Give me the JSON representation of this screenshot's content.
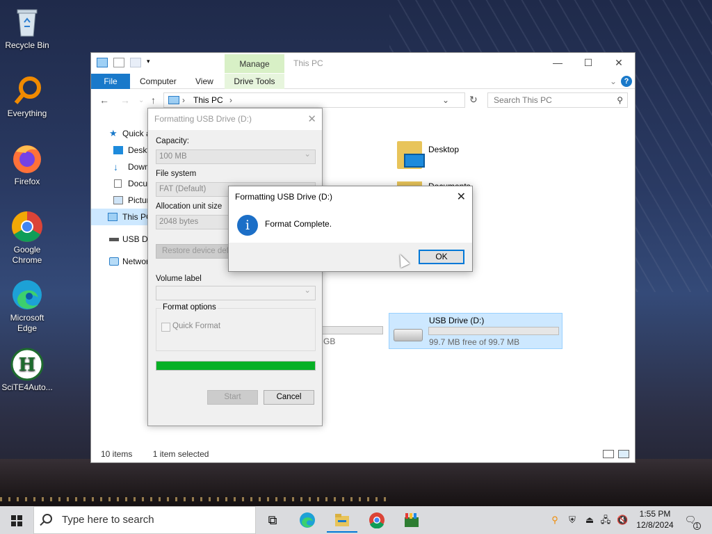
{
  "desktop": {
    "icons": [
      {
        "label": "Recycle Bin"
      },
      {
        "label": "Everything"
      },
      {
        "label": "Firefox"
      },
      {
        "label": "Google Chrome"
      },
      {
        "label": "Microsoft Edge"
      },
      {
        "label": "SciTE4Auto..."
      }
    ]
  },
  "explorer": {
    "title": "This PC",
    "manage_tab": "Manage",
    "ribbon_tabs": {
      "file": "File",
      "computer": "Computer",
      "view": "View",
      "drive_tools": "Drive Tools"
    },
    "help": "?",
    "address": "This PC",
    "search_placeholder": "Search This PC",
    "nav": [
      {
        "label": "Quick access"
      },
      {
        "label": "Desktop"
      },
      {
        "label": "Downloads"
      },
      {
        "label": "Documents"
      },
      {
        "label": "Pictures"
      },
      {
        "label": "This PC"
      },
      {
        "label": "USB Drive (D:)"
      },
      {
        "label": "Network"
      }
    ],
    "folder_desktop": "Desktop",
    "folder_documents": "Documents",
    "other_drive_size": "GB",
    "usb": {
      "name": "USB Drive (D:)",
      "free": "99.7 MB free of 99.7 MB",
      "used_fraction": 0.0
    },
    "status": {
      "items": "10 items",
      "selected": "1 item selected"
    }
  },
  "format_dialog": {
    "title": "Formatting USB Drive (D:)",
    "capacity_label": "Capacity:",
    "capacity_value": "100 MB",
    "fs_label": "File system",
    "fs_value": "FAT (Default)",
    "alloc_label": "Allocation unit size",
    "alloc_value": "2048 bytes",
    "restore_button": "Restore device defaults",
    "volume_label": "Volume label",
    "volume_value": "",
    "options_label": "Format options",
    "quick_format": "Quick Format",
    "progress": 1.0,
    "start_button": "Start",
    "cancel_button": "Cancel"
  },
  "complete_dialog": {
    "title": "Formatting USB Drive (D:)",
    "message": "Format Complete.",
    "ok_button": "OK"
  },
  "taskbar": {
    "search_placeholder": "Type here to search",
    "time": "1:55 PM",
    "date": "12/8/2024",
    "notification_count": "1"
  },
  "colors": {
    "accent": "#0078d7",
    "progress": "#06b025",
    "manage": "#d8f0c6",
    "selection": "#cde8ff"
  }
}
